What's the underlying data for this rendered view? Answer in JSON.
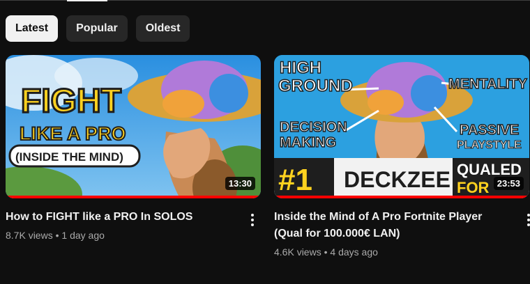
{
  "filters": {
    "chips": [
      {
        "label": "Latest",
        "active": true
      },
      {
        "label": "Popular",
        "active": false
      },
      {
        "label": "Oldest",
        "active": false
      }
    ]
  },
  "videos": [
    {
      "title": "How to FIGHT like a PRO In SOLOS",
      "views": "8.7K views",
      "age": "1 day ago",
      "duration": "13:30",
      "thumbnail_text": {
        "line1": "FIGHT",
        "line2": "LIKE A PRO",
        "line3": "(INSIDE THE MIND)"
      },
      "watched_fraction": 1.0
    },
    {
      "title": "Inside the Mind of A Pro Fortnite Player (Qual for 100.000€ LAN)",
      "views": "4.6K views",
      "age": "4 days ago",
      "duration": "23:53",
      "thumbnail_text": {
        "high": "HIGH",
        "ground": "GROUND",
        "mentality": "MENTALITY",
        "decision": "DECISION",
        "making": "MAKING",
        "passive": "PASSIVE",
        "playstyle": "PLAYSTYLE",
        "rank": "#1",
        "name": "DECKZEE",
        "qualed": "QUALED",
        "for": "FOR"
      },
      "watched_fraction": 1.0
    }
  ],
  "colors": {
    "accent_progress": "#ff0000",
    "background": "#0f0f0f"
  }
}
